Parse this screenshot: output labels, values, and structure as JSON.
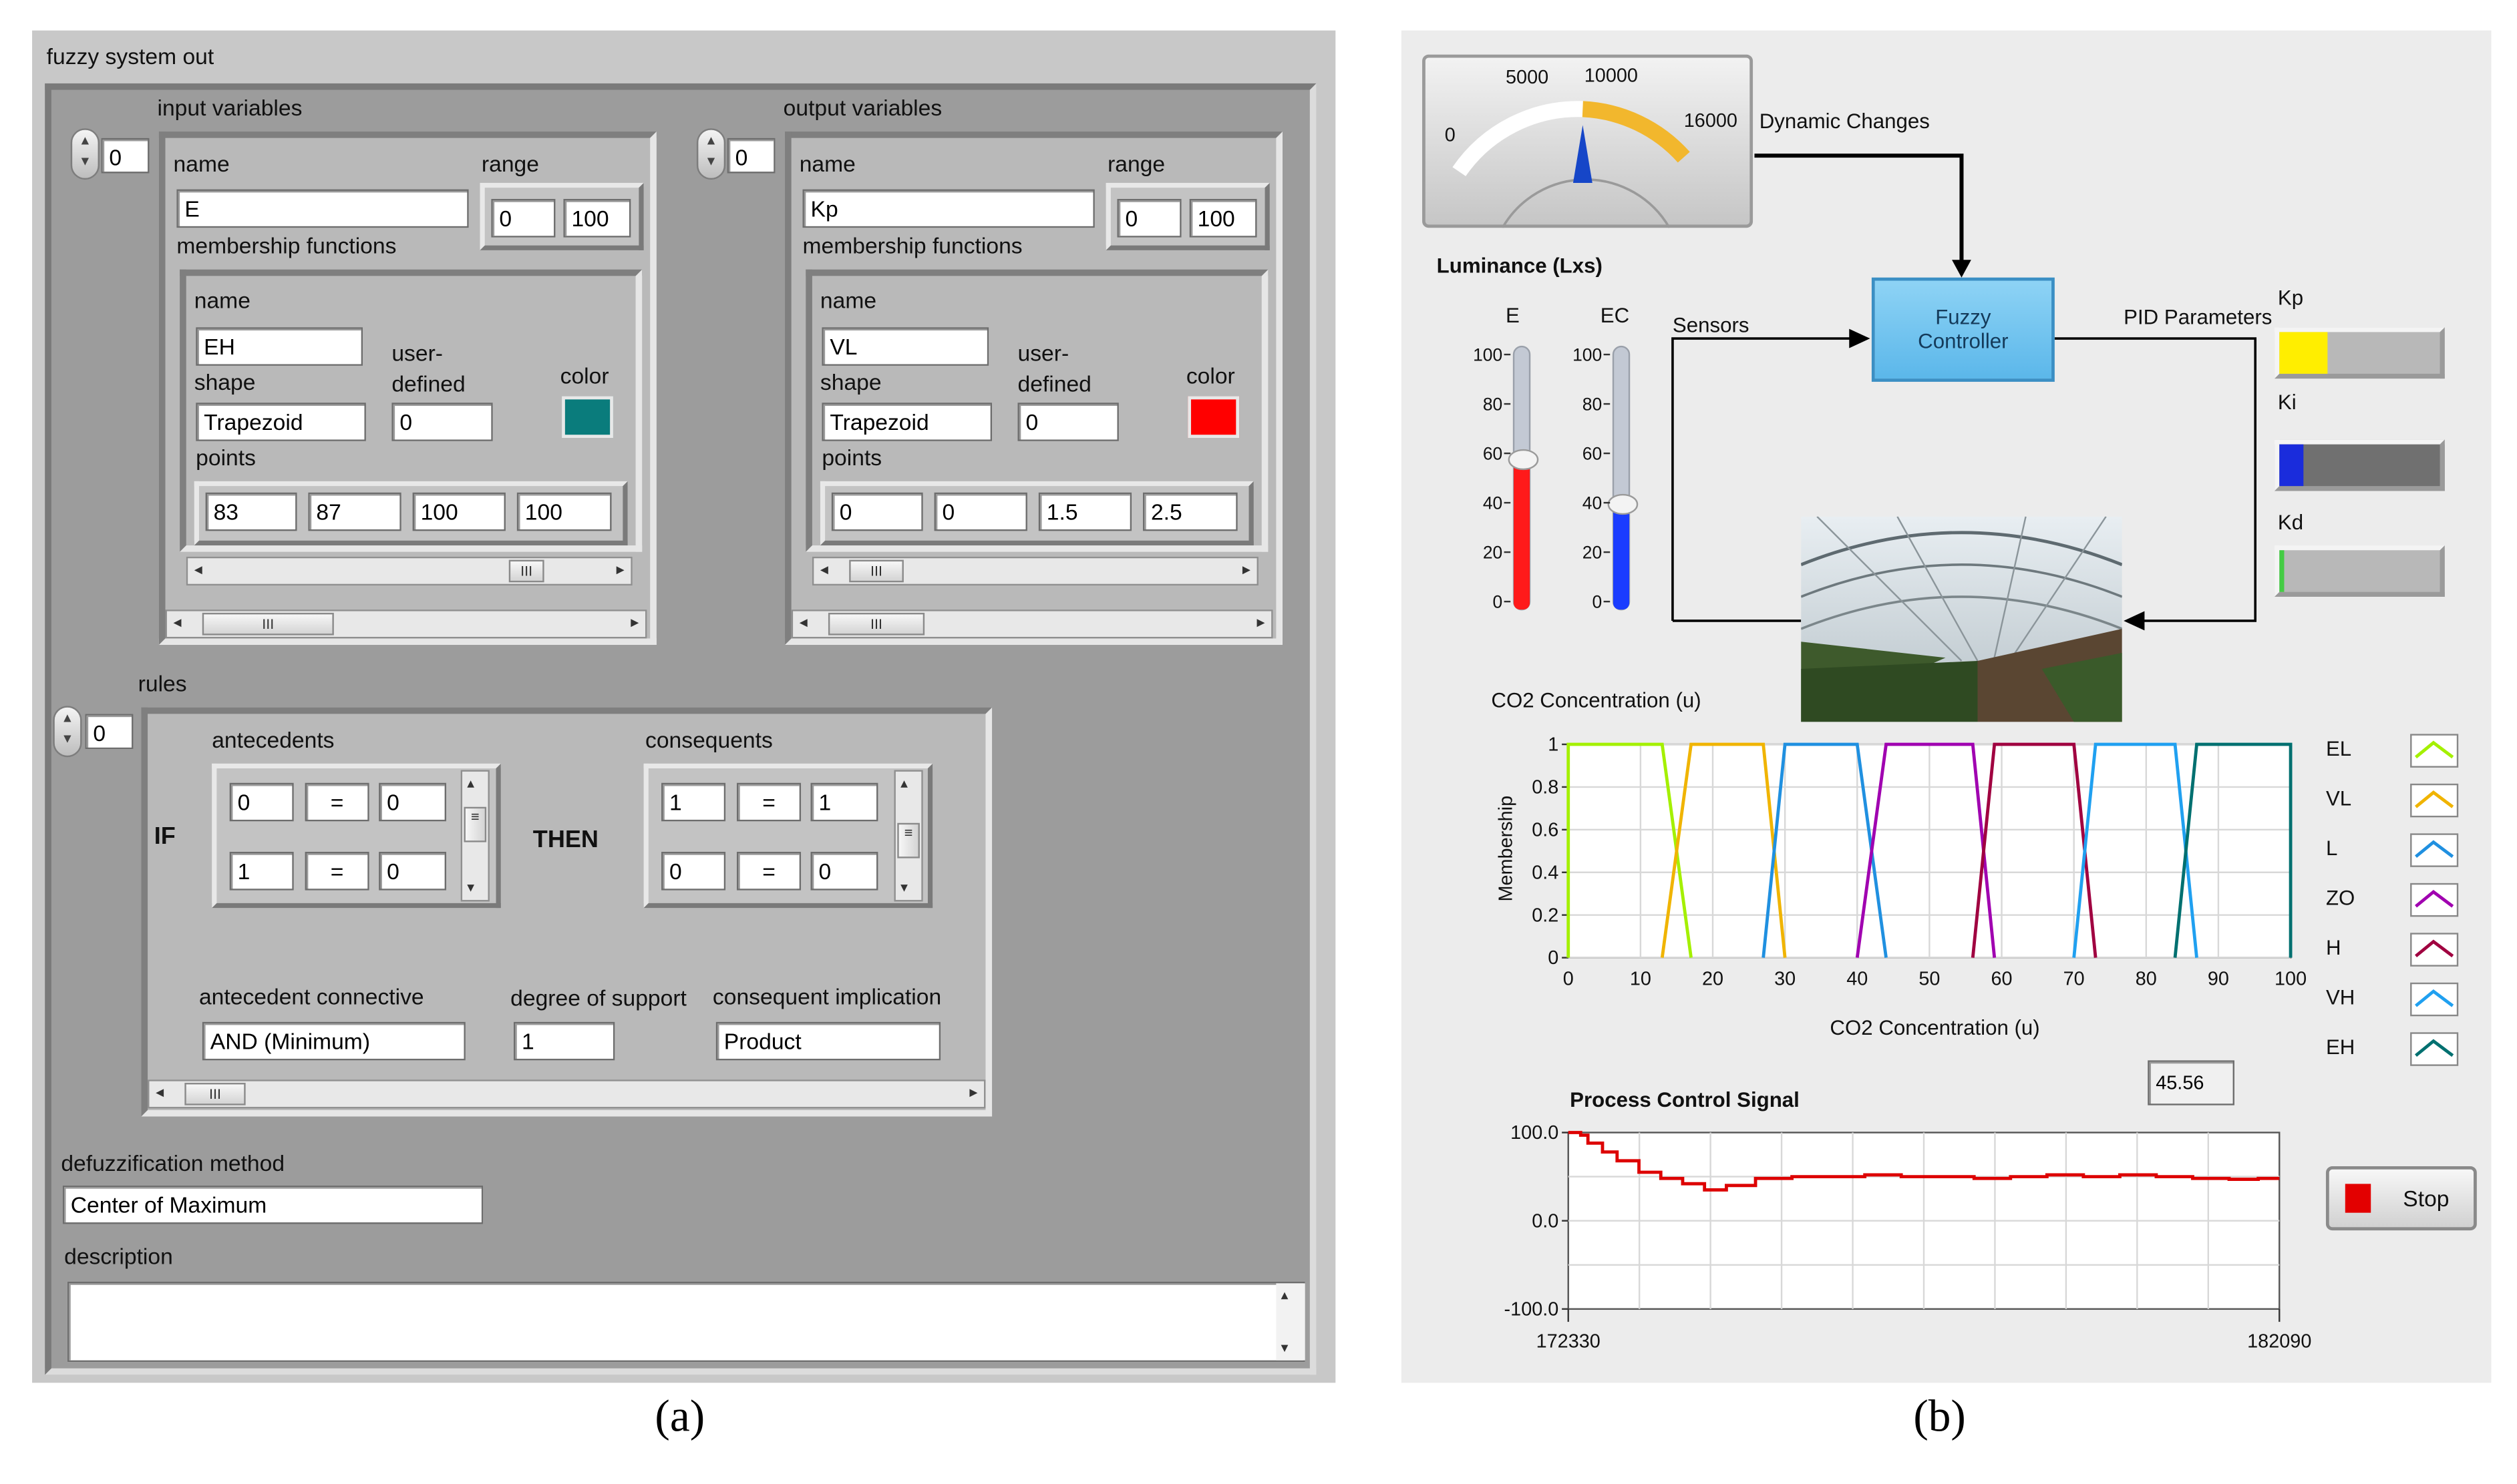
{
  "left_panel": {
    "title": "fuzzy system out",
    "input_variables": {
      "label": "input variables",
      "index": "0",
      "name_label": "name",
      "name_value": "E",
      "range_label": "range",
      "range_min": "0",
      "range_max": "100",
      "mf_label": "membership functions",
      "mf": {
        "name_label": "name",
        "name_value": "EH",
        "shape_label": "shape",
        "shape_value": "Trapezoid",
        "user_defined_label1": "user-",
        "user_defined_label2": "defined",
        "user_defined_value": "0",
        "color_label": "color",
        "color_value": "#0a7c7c",
        "points_label": "points",
        "points": [
          "83",
          "87",
          "100",
          "100"
        ]
      }
    },
    "output_variables": {
      "label": "output variables",
      "index": "0",
      "name_label": "name",
      "name_value": "Kp",
      "range_label": "range",
      "range_min": "0",
      "range_max": "100",
      "mf_label": "membership functions",
      "mf": {
        "name_label": "name",
        "name_value": "VL",
        "shape_label": "shape",
        "shape_value": "Trapezoid",
        "user_defined_label1": "user-",
        "user_defined_label2": "defined",
        "user_defined_value": "0",
        "color_label": "color",
        "color_value": "#ff0000",
        "points_label": "points",
        "points": [
          "0",
          "0",
          "1.5",
          "2.5"
        ]
      }
    },
    "rules": {
      "label": "rules",
      "index": "0",
      "if_label": "IF",
      "then_label": "THEN",
      "antecedents_label": "antecedents",
      "consequents_label": "consequents",
      "antecedents": [
        [
          "0",
          "=",
          "0"
        ],
        [
          "1",
          "=",
          "0"
        ]
      ],
      "consequents": [
        [
          "1",
          "=",
          "1"
        ],
        [
          "0",
          "=",
          "0"
        ]
      ],
      "antecedent_connective_label": "antecedent connective",
      "antecedent_connective_value": "AND (Minimum)",
      "degree_of_support_label": "degree of support",
      "degree_of_support_value": "1",
      "consequent_implication_label": "consequent implication",
      "consequent_implication_value": "Product"
    },
    "defuzz_label": "defuzzification method",
    "defuzz_value": "Center of Maximum",
    "description_label": "description",
    "description_value": ""
  },
  "right_panel": {
    "gauge": {
      "ticks": [
        "0",
        "5000",
        "10000",
        "16000"
      ],
      "label": "Luminance (Lxs)",
      "value": 10000,
      "max": 16000
    },
    "dynamic_changes_label": "Dynamic Changes",
    "sensors_label": "Sensors",
    "fuzzy_controller_line1": "Fuzzy",
    "fuzzy_controller_line2": "Controller",
    "pid_parameters_label": "PID Parameters",
    "thermometers": [
      {
        "label": "E",
        "value": 57,
        "max": 100,
        "fill": "#ff1a1a",
        "ticks": [
          "100",
          "80",
          "60",
          "40",
          "20",
          "0"
        ]
      },
      {
        "label": "EC",
        "value": 40,
        "max": 100,
        "fill": "#1a3cff",
        "ticks": [
          "100",
          "80",
          "60",
          "40",
          "20",
          "0"
        ]
      }
    ],
    "pid_bars": [
      {
        "label": "Kp",
        "fill": "#ffee00",
        "fraction": 0.3,
        "bg": "#b8b8b8"
      },
      {
        "label": "Ki",
        "fill": "#1a2cdc",
        "fraction": 0.15,
        "bg": "#707070"
      },
      {
        "label": "Kd",
        "fill": "#44cc44",
        "fraction": 0.02,
        "bg": "#b8b8b8"
      }
    ],
    "co2_label": "CO2 Concentration (u)",
    "process_signal_label": "Process Control Signal",
    "process_value": "45.56",
    "stop_label": "Stop"
  },
  "chart_data": [
    {
      "type": "line",
      "title": "CO2 Concentration (u)",
      "xlabel": "CO2 Concentration (u)",
      "ylabel": "Membership",
      "xlim": [
        0,
        100
      ],
      "ylim": [
        0,
        1
      ],
      "x_ticks": [
        "0",
        "10",
        "20",
        "30",
        "40",
        "50",
        "60",
        "70",
        "80",
        "90",
        "100"
      ],
      "y_ticks": [
        "1",
        "0.8",
        "0.6",
        "0.4",
        "0.2",
        "0"
      ],
      "grid": true,
      "legend_position": "right",
      "series": [
        {
          "name": "EL",
          "color": "#a4f000",
          "x": [
            0,
            0,
            13,
            17
          ],
          "y": [
            0,
            1,
            1,
            0
          ]
        },
        {
          "name": "VL",
          "color": "#f0b400",
          "x": [
            13,
            17,
            27,
            30
          ],
          "y": [
            0,
            1,
            1,
            0
          ]
        },
        {
          "name": "L",
          "color": "#2090e0",
          "x": [
            27,
            30,
            40,
            44
          ],
          "y": [
            0,
            1,
            1,
            0
          ]
        },
        {
          "name": "ZO",
          "color": "#a000b0",
          "x": [
            40,
            44,
            56,
            59
          ],
          "y": [
            0,
            1,
            1,
            0
          ]
        },
        {
          "name": "H",
          "color": "#a00040",
          "x": [
            56,
            59,
            70,
            73
          ],
          "y": [
            0,
            1,
            1,
            0
          ]
        },
        {
          "name": "VH",
          "color": "#20a0f0",
          "x": [
            70,
            73,
            84,
            87
          ],
          "y": [
            0,
            1,
            1,
            0
          ]
        },
        {
          "name": "EH",
          "color": "#007070",
          "x": [
            84,
            87,
            100,
            100
          ],
          "y": [
            0,
            1,
            1,
            0
          ]
        }
      ]
    },
    {
      "type": "line",
      "title": "Process Control Signal",
      "xlabel": "",
      "ylabel": "",
      "xlim": [
        172330,
        182090
      ],
      "ylim": [
        -100,
        100
      ],
      "x_ticks": [
        "172330",
        "182090"
      ],
      "y_ticks": [
        "100.0",
        "0.0",
        "-100.0"
      ],
      "grid": true,
      "series": [
        {
          "name": "",
          "color": "#dd0000",
          "x": [
            172330,
            172500,
            172600,
            172800,
            173000,
            173300,
            173600,
            173900,
            174200,
            174500,
            174900,
            175400,
            175900,
            176400,
            176900,
            177400,
            177900,
            178400,
            178900,
            179400,
            179900,
            180400,
            180900,
            181400,
            181800,
            182090
          ],
          "y": [
            100,
            97,
            88,
            78,
            68,
            55,
            48,
            42,
            35,
            40,
            48,
            50,
            50,
            52,
            50,
            50,
            48,
            50,
            52,
            50,
            52,
            50,
            48,
            47,
            48,
            48
          ]
        }
      ]
    }
  ],
  "captions": {
    "a": "(a)",
    "b": "(b)"
  }
}
